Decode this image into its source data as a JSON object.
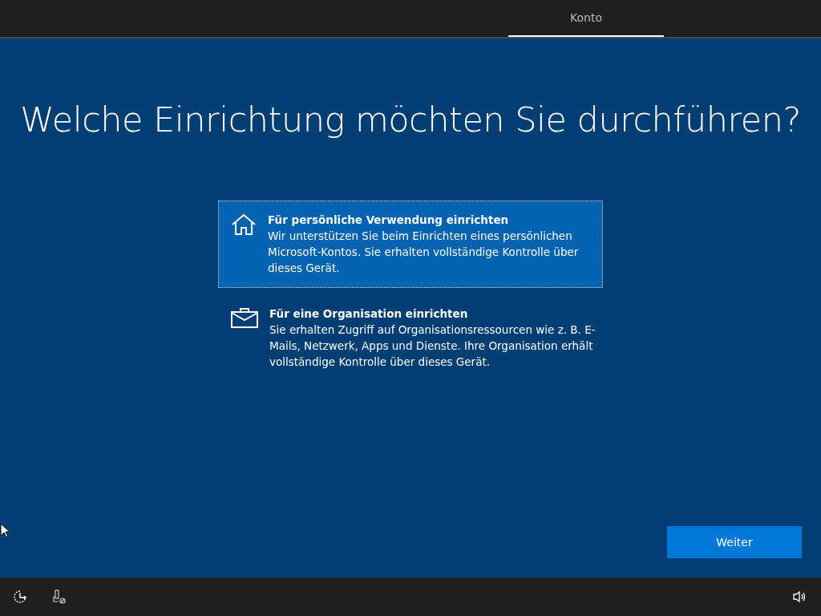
{
  "top_bar": {
    "tabs": [
      {
        "label": "Konto",
        "selected": true
      }
    ]
  },
  "heading": "Welche Einrichtung möchten Sie durchführen?",
  "options": [
    {
      "kind": "home",
      "title": "Für persönliche Verwendung einrichten",
      "description": "Wir unterstützen Sie beim Einrichten eines persönlichen Microsoft-Kontos. Sie erhalten vollständige Kontrolle über dieses Gerät.",
      "selected": true
    },
    {
      "kind": "work",
      "title": "Für eine Organisation einrichten",
      "description": "Sie erhalten Zugriff auf Organisationsressourcen wie z. B. E-Mails, Netzwerk, Apps und Dienste. Ihre Organisation erhält vollständige Kontrolle über dieses Gerät.",
      "selected": false
    }
  ],
  "next_button": "Weiter"
}
